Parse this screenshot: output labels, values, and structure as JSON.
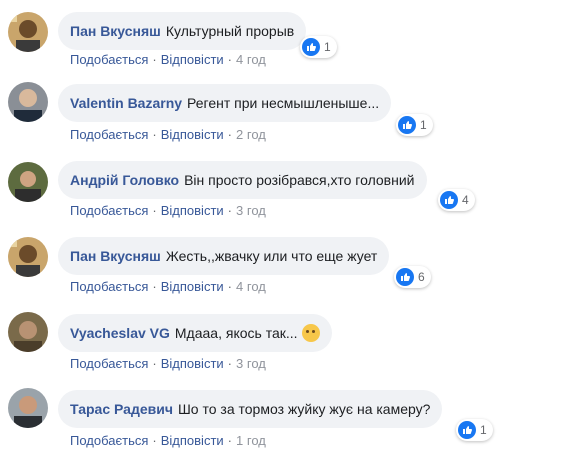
{
  "accent": "#385898",
  "like_color": "#1877f2",
  "comments": [
    {
      "author": "Пан Вкусняш",
      "text": "Культурный прорыв",
      "reactions": "1",
      "like": "Подобається",
      "reply": "Відповісти",
      "time": "4 год",
      "avatar_icon": "avatar"
    },
    {
      "author": "Valentin Bazarny",
      "text": "Регент при несмышленыше...",
      "reactions": "1",
      "like": "Подобається",
      "reply": "Відповісти",
      "time": "2 год",
      "avatar_icon": "avatar"
    },
    {
      "author": "Андрій Головко",
      "text": "Він просто розібрався,хто головний",
      "reactions": "4",
      "like": "Подобається",
      "reply": "Відповісти",
      "time": "3 год",
      "avatar_icon": "avatar"
    },
    {
      "author": "Пан Вкусняш",
      "text": "Жесть,,жвачку или что еще жует",
      "reactions": "6",
      "like": "Подобається",
      "reply": "Відповісти",
      "time": "4 год",
      "avatar_icon": "avatar"
    },
    {
      "author": "Vyacheslav VG",
      "text": "Мдааа, якось так...",
      "reactions": "",
      "like": "Подобається",
      "reply": "Відповісти",
      "time": "3 год",
      "avatar_icon": "avatar",
      "emoji": "thinking-face"
    },
    {
      "author": "Тарас Радевич",
      "text": "Шо то за тормоз жуйку жує на камеру?",
      "reactions": "1",
      "like": "Подобається",
      "reply": "Відповісти",
      "time": "1 год",
      "avatar_icon": "avatar"
    }
  ]
}
